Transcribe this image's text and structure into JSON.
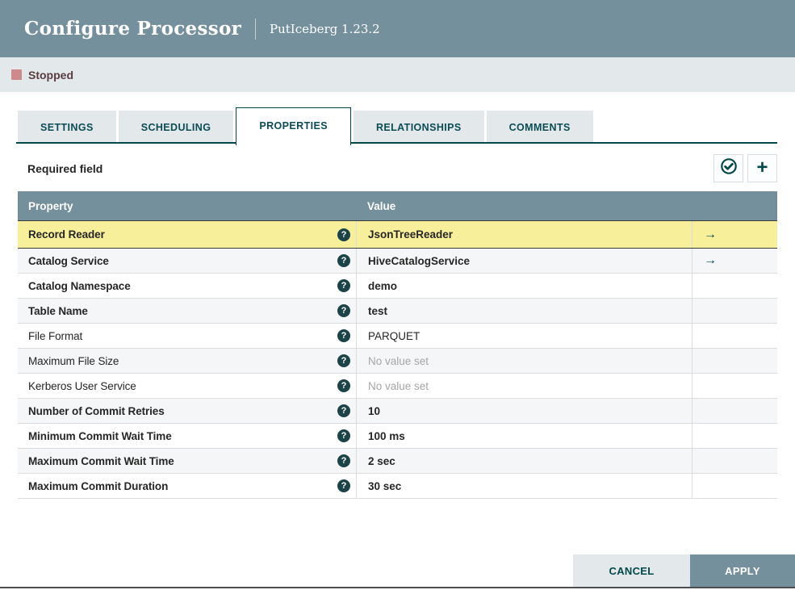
{
  "dialog": {
    "title": "Configure Processor",
    "subtitle": "PutIceberg 1.23.2"
  },
  "status_bar": {
    "label": "Stopped",
    "icon": "stopped-square-icon"
  },
  "tabs": [
    {
      "label": "SETTINGS",
      "active": false
    },
    {
      "label": "SCHEDULING",
      "active": false
    },
    {
      "label": "PROPERTIES",
      "active": true
    },
    {
      "label": "RELATIONSHIPS",
      "active": false
    },
    {
      "label": "COMMENTS",
      "active": false
    }
  ],
  "properties_panel": {
    "required_hint": "Required field",
    "toolbar_icons": [
      {
        "name": "verify-properties-icon"
      },
      {
        "name": "add-property-icon"
      }
    ],
    "table": {
      "columns": [
        "Property",
        "Value"
      ],
      "rows": [
        {
          "name": "Record Reader",
          "value": "JsonTreeReader",
          "required": true,
          "highlighted": true,
          "has_arrow": true,
          "value_set": true
        },
        {
          "name": "Catalog Service",
          "value": "HiveCatalogService",
          "required": true,
          "highlighted": false,
          "has_arrow": true,
          "value_set": true
        },
        {
          "name": "Catalog Namespace",
          "value": "demo",
          "required": true,
          "highlighted": false,
          "has_arrow": false,
          "value_set": true
        },
        {
          "name": "Table Name",
          "value": "test",
          "required": true,
          "highlighted": false,
          "has_arrow": false,
          "value_set": true
        },
        {
          "name": "File Format",
          "value": "PARQUET",
          "required": false,
          "highlighted": false,
          "has_arrow": false,
          "value_set": true
        },
        {
          "name": "Maximum File Size",
          "value": "No value set",
          "required": false,
          "highlighted": false,
          "has_arrow": false,
          "value_set": false
        },
        {
          "name": "Kerberos User Service",
          "value": "No value set",
          "required": false,
          "highlighted": false,
          "has_arrow": false,
          "value_set": false
        },
        {
          "name": "Number of Commit Retries",
          "value": "10",
          "required": true,
          "highlighted": false,
          "has_arrow": false,
          "value_set": true
        },
        {
          "name": "Minimum Commit Wait Time",
          "value": "100 ms",
          "required": true,
          "highlighted": false,
          "has_arrow": false,
          "value_set": true
        },
        {
          "name": "Maximum Commit Wait Time",
          "value": "2 sec",
          "required": true,
          "highlighted": false,
          "has_arrow": false,
          "value_set": true
        },
        {
          "name": "Maximum Commit Duration",
          "value": "30 sec",
          "required": true,
          "highlighted": false,
          "has_arrow": false,
          "value_set": true
        }
      ]
    }
  },
  "footer": {
    "cancel_label": "CANCEL",
    "apply_label": "APPLY"
  },
  "colors": {
    "accent_teal": "#004849",
    "slate_header": "#75909d",
    "status_bar_bg": "#e3e8eb",
    "stopped_red": "#cd8a8d",
    "stopped_text": "#5a3d40",
    "highlight_yellow": "#f8ef9b",
    "row_alt_bg": "#f4f6f7",
    "unset_text": "#a6a6a6"
  }
}
